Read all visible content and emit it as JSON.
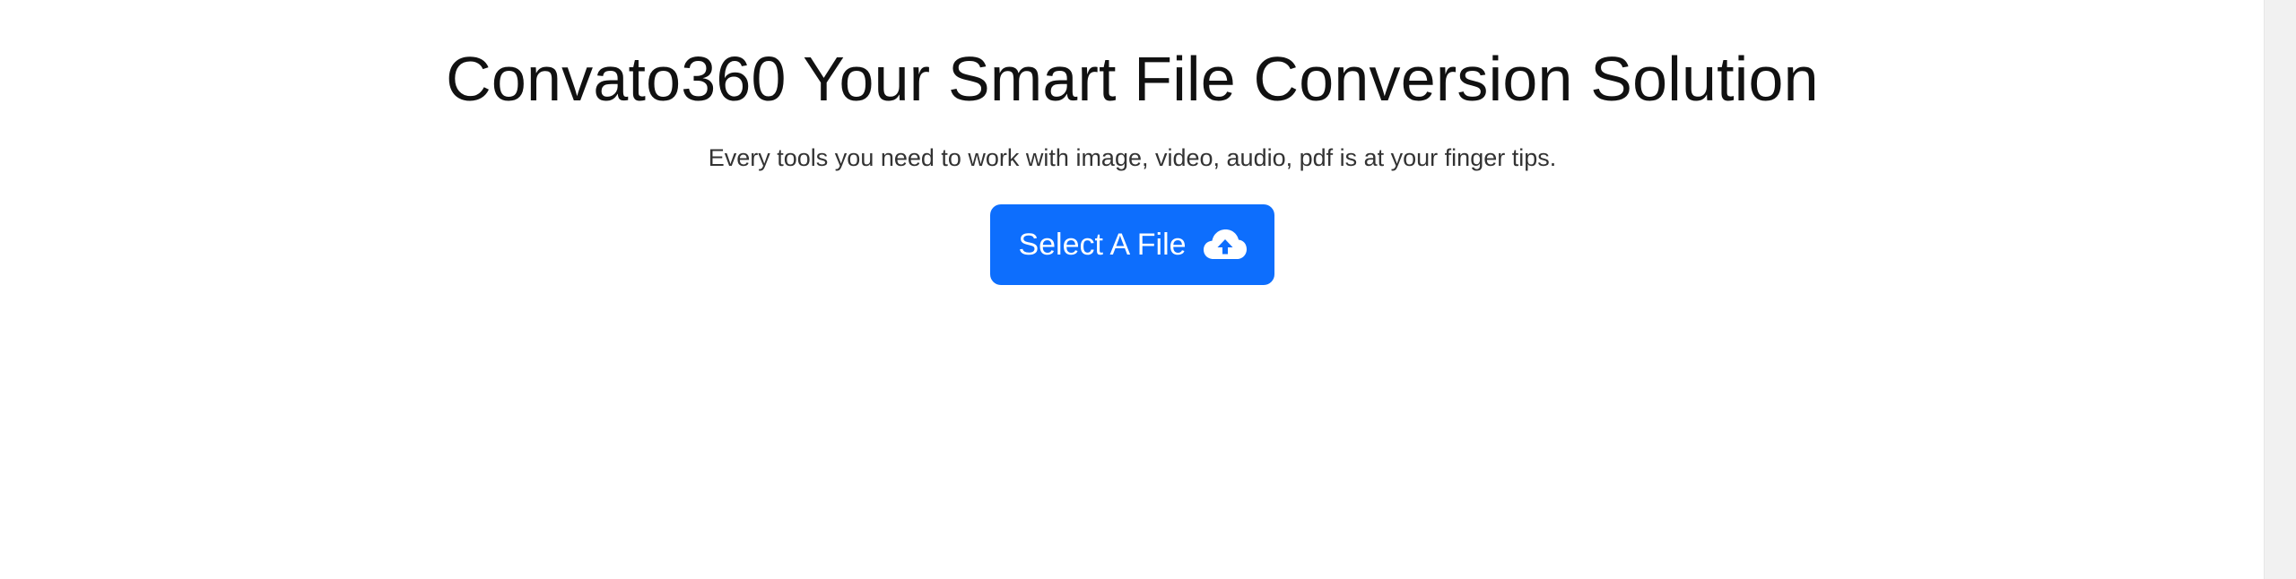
{
  "hero": {
    "title": "Convato360 Your Smart File Conversion Solution",
    "subtitle": "Every tools you need to work with image, video, audio, pdf is at your finger tips.",
    "select_button_label": "Select A File",
    "select_button_icon": "cloud-upload-icon"
  },
  "colors": {
    "accent": "#0d6efd",
    "title_text": "#111111",
    "subtitle_text": "#333333",
    "background": "#ffffff",
    "scrollbar_track": "#f1f1f1"
  }
}
